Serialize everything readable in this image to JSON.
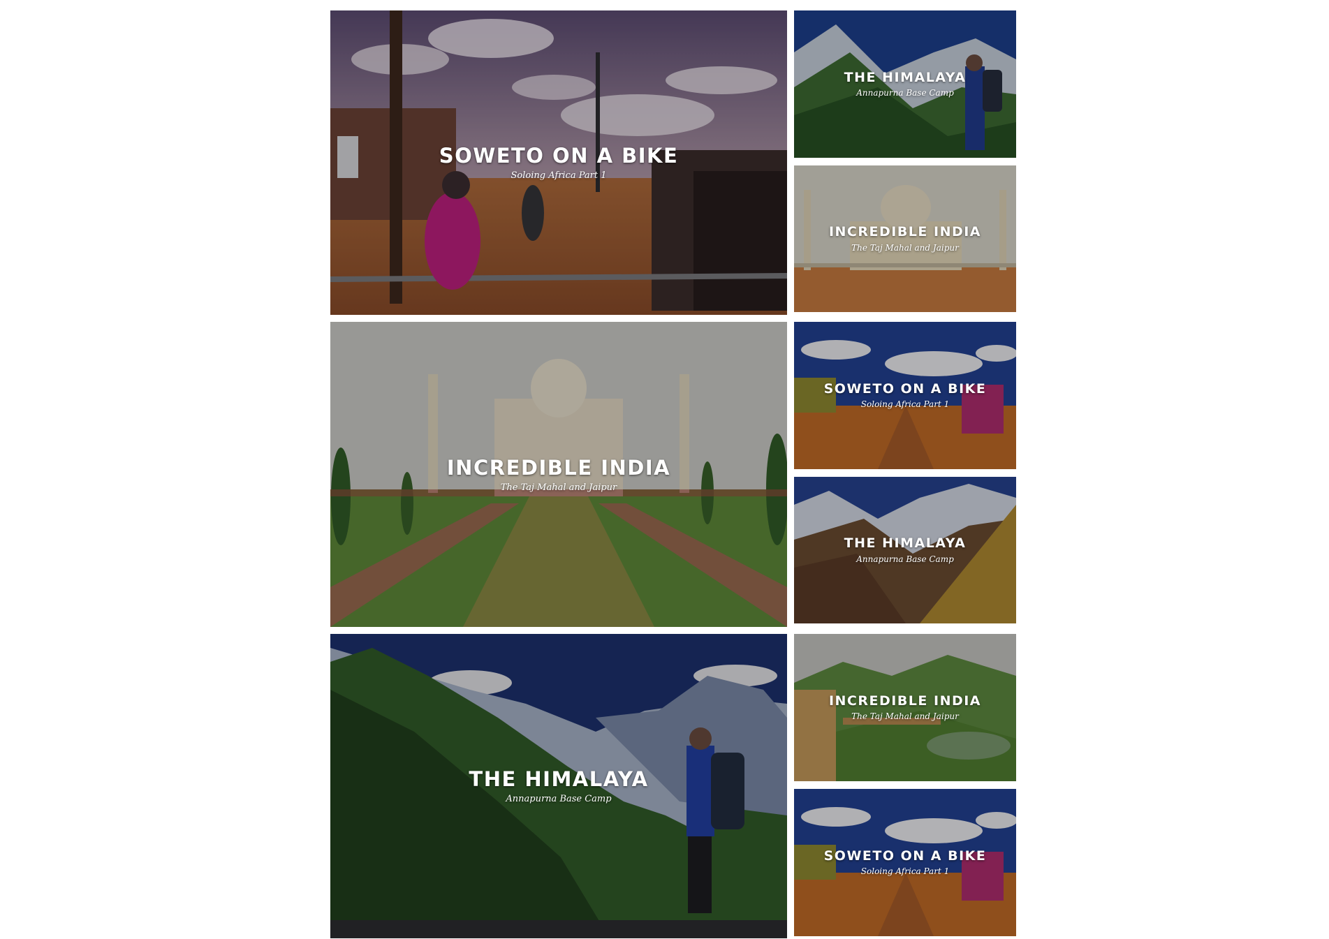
{
  "gallery": {
    "cards": [
      {
        "title": "SOWETO ON A BIKE",
        "subtitle": "Soloing Africa Part 1",
        "scene": "soweto"
      },
      {
        "title": "THE HIMALAYA",
        "subtitle": "Annapurna Base Camp",
        "scene": "himalaya"
      },
      {
        "title": "INCREDIBLE INDIA",
        "subtitle": "The Taj Mahal and Jaipur",
        "scene": "taj"
      },
      {
        "title": "INCREDIBLE INDIA",
        "subtitle": "The Taj Mahal and Jaipur",
        "scene": "taj"
      },
      {
        "title": "SOWETO ON A BIKE",
        "subtitle": "Soloing Africa Part 1",
        "scene": "soweto"
      },
      {
        "title": "THE HIMALAYA",
        "subtitle": "Annapurna Base Camp",
        "scene": "himalaya"
      },
      {
        "title": "THE HIMALAYA",
        "subtitle": "Annapurna Base Camp",
        "scene": "himalaya"
      },
      {
        "title": "INCREDIBLE INDIA",
        "subtitle": "The Taj Mahal and Jaipur",
        "scene": "jaipur"
      },
      {
        "title": "SOWETO ON A BIKE",
        "subtitle": "Soloing Africa Part 1",
        "scene": "soweto"
      }
    ]
  }
}
